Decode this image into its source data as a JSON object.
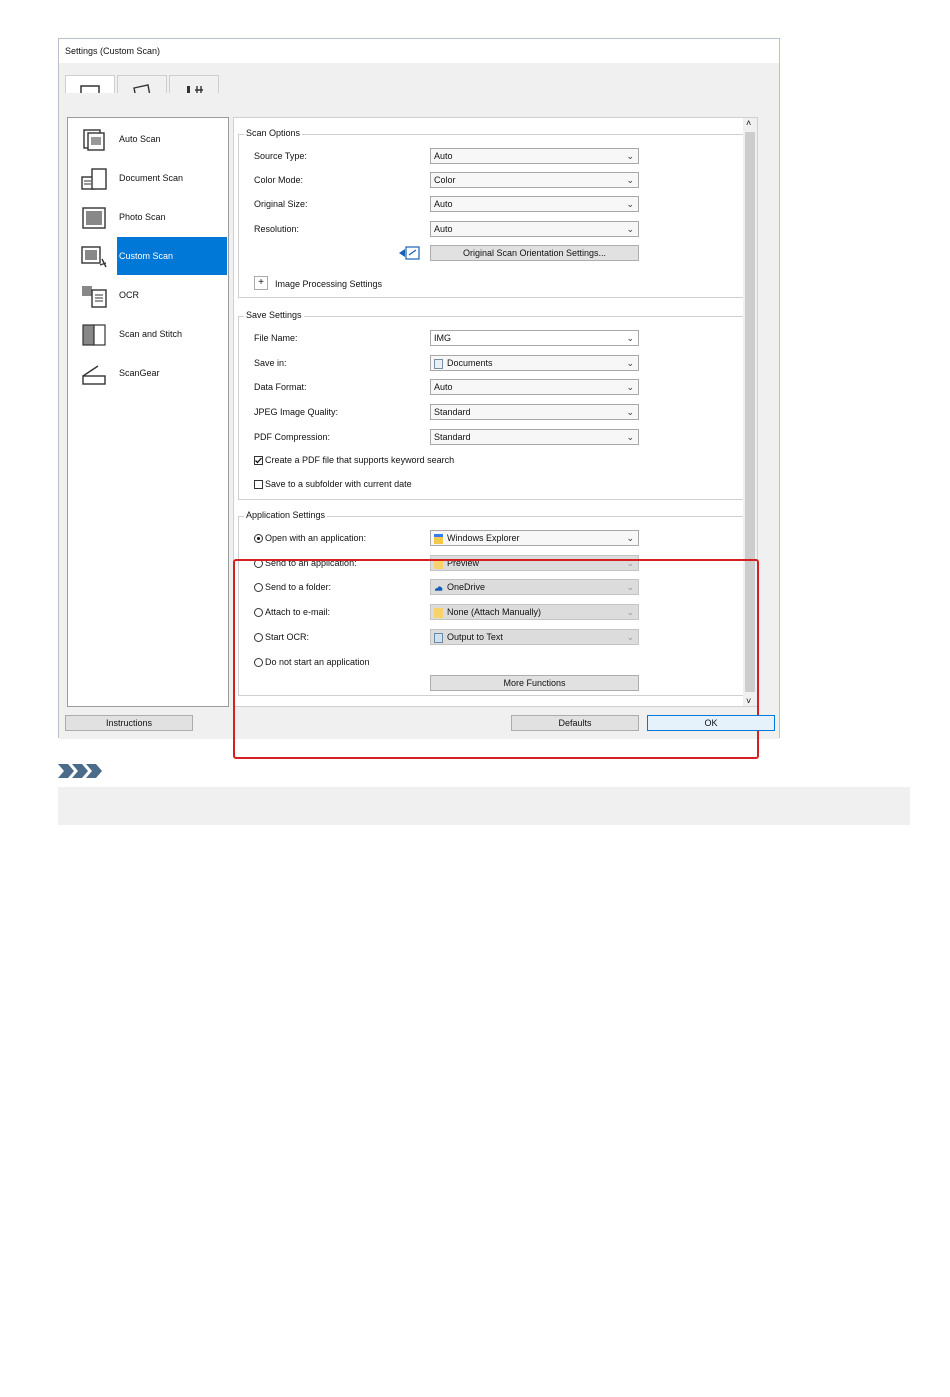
{
  "window": {
    "title": "Settings (Custom Scan)"
  },
  "tabs": [
    {
      "name": "scan-from-computer-icon"
    },
    {
      "name": "scan-from-operation-panel-icon"
    },
    {
      "name": "general-settings-icon"
    }
  ],
  "sidebar": {
    "items": [
      {
        "label": "Auto Scan"
      },
      {
        "label": "Document Scan"
      },
      {
        "label": "Photo Scan"
      },
      {
        "label": "Custom Scan",
        "selected": true
      },
      {
        "label": "OCR"
      },
      {
        "label": "Scan and Stitch"
      },
      {
        "label": "ScanGear"
      }
    ]
  },
  "scan_options": {
    "title": "Scan Options",
    "source_type": {
      "label": "Source Type:",
      "value": "Auto"
    },
    "color_mode": {
      "label": "Color Mode:",
      "value": "Color"
    },
    "original_size": {
      "label": "Original Size:",
      "value": "Auto"
    },
    "resolution": {
      "label": "Resolution:",
      "value": "Auto"
    },
    "orientation_button": "Original Scan Orientation Settings...",
    "image_processing": {
      "expander": "+",
      "label": "Image Processing Settings"
    }
  },
  "save_settings": {
    "title": "Save Settings",
    "file_name": {
      "label": "File Name:",
      "value": "IMG"
    },
    "save_in": {
      "label": "Save in:",
      "value": "Documents"
    },
    "data_format": {
      "label": "Data Format:",
      "value": "Auto"
    },
    "jpeg_quality": {
      "label": "JPEG Image Quality:",
      "value": "Standard"
    },
    "pdf_compression": {
      "label": "PDF Compression:",
      "value": "Standard"
    },
    "keyword_search": {
      "label": "Create a PDF file that supports keyword search",
      "checked": true
    },
    "subfolder": {
      "label": "Save to a subfolder with current date",
      "checked": false
    }
  },
  "application_settings": {
    "title": "Application Settings",
    "open_app": {
      "label": "Open with an application:",
      "value": "Windows Explorer",
      "selected": true
    },
    "send_app": {
      "label": "Send to an application:",
      "value": "Preview"
    },
    "send_folder": {
      "label": "Send to a folder:",
      "value": "OneDrive"
    },
    "attach_email": {
      "label": "Attach to e-mail:",
      "value": "None (Attach Manually)"
    },
    "start_ocr": {
      "label": "Start OCR:",
      "value": "Output to Text"
    },
    "no_app": {
      "label": "Do not start an application"
    },
    "more_functions": "More Functions"
  },
  "footer": {
    "instructions": "Instructions",
    "defaults": "Defaults",
    "ok": "OK"
  },
  "colors": {
    "selection": "#0078d7",
    "highlight_box": "#d42020"
  }
}
